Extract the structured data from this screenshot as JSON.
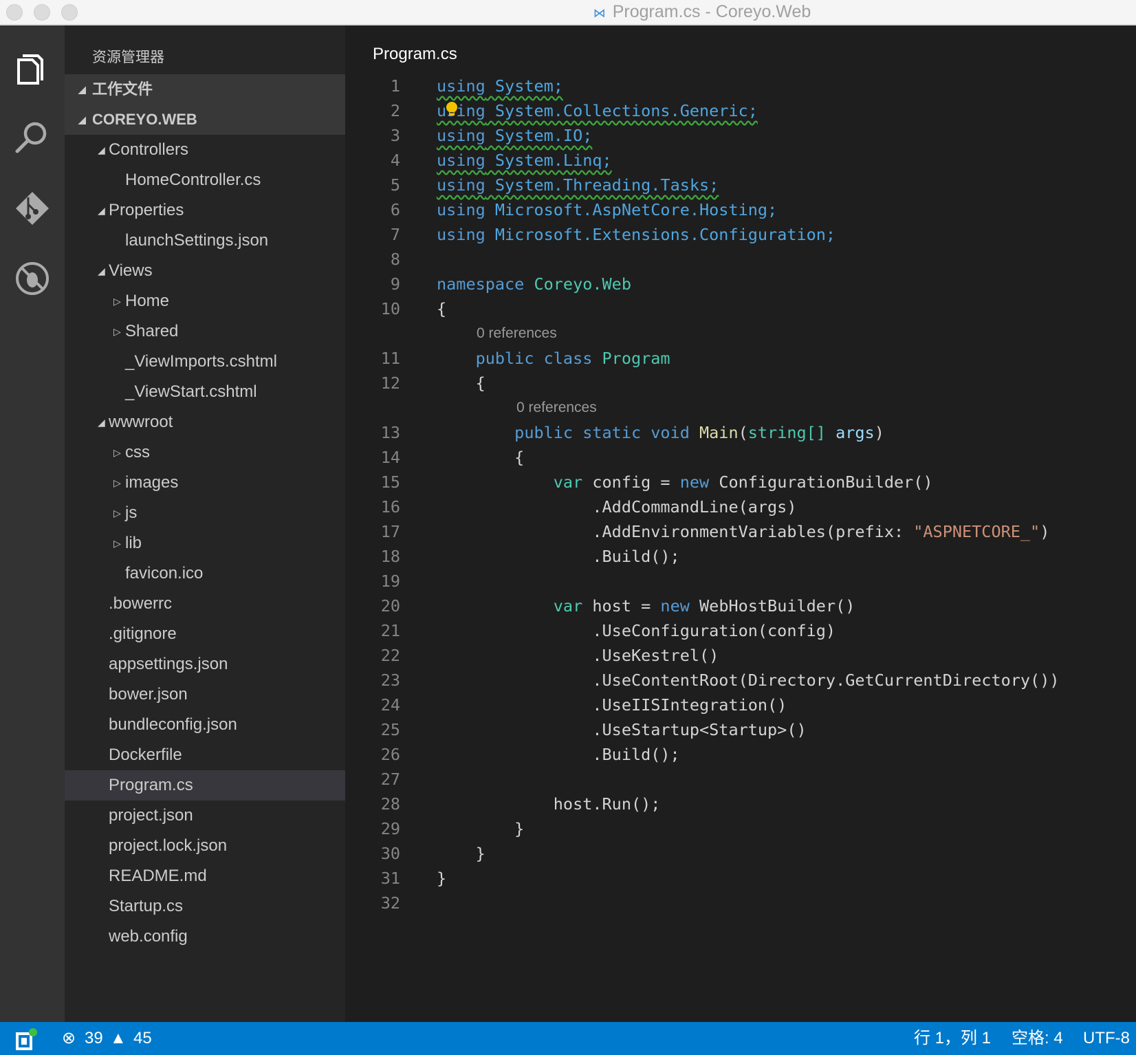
{
  "window": {
    "title": "Program.cs - Coreyo.Web"
  },
  "activity_bar": {
    "items": [
      "explorer-icon",
      "search-icon",
      "git-icon",
      "debug-icon"
    ]
  },
  "sidebar": {
    "title": "资源管理器",
    "items": [
      {
        "label": "工作文件",
        "level": 0,
        "twisty": "expanded",
        "header": true
      },
      {
        "label": "COREYO.WEB",
        "level": 0,
        "twisty": "expanded",
        "header": true
      },
      {
        "label": "Controllers",
        "level": 1,
        "twisty": "expanded"
      },
      {
        "label": "HomeController.cs",
        "level": 2
      },
      {
        "label": "Properties",
        "level": 1,
        "twisty": "expanded"
      },
      {
        "label": "launchSettings.json",
        "level": 2
      },
      {
        "label": "Views",
        "level": 1,
        "twisty": "expanded"
      },
      {
        "label": "Home",
        "level": 2,
        "twisty": "collapsed"
      },
      {
        "label": "Shared",
        "level": 2,
        "twisty": "collapsed"
      },
      {
        "label": "_ViewImports.cshtml",
        "level": 2
      },
      {
        "label": "_ViewStart.cshtml",
        "level": 2
      },
      {
        "label": "wwwroot",
        "level": 1,
        "twisty": "expanded"
      },
      {
        "label": "css",
        "level": 2,
        "twisty": "collapsed"
      },
      {
        "label": "images",
        "level": 2,
        "twisty": "collapsed"
      },
      {
        "label": "js",
        "level": 2,
        "twisty": "collapsed"
      },
      {
        "label": "lib",
        "level": 2,
        "twisty": "collapsed"
      },
      {
        "label": "favicon.ico",
        "level": 2
      },
      {
        "label": ".bowerrc",
        "level": 1
      },
      {
        "label": ".gitignore",
        "level": 1
      },
      {
        "label": "appsettings.json",
        "level": 1
      },
      {
        "label": "bower.json",
        "level": 1
      },
      {
        "label": "bundleconfig.json",
        "level": 1
      },
      {
        "label": "Dockerfile",
        "level": 1
      },
      {
        "label": "Program.cs",
        "level": 1,
        "selected": true
      },
      {
        "label": "project.json",
        "level": 1
      },
      {
        "label": "project.lock.json",
        "level": 1
      },
      {
        "label": "README.md",
        "level": 1
      },
      {
        "label": "Startup.cs",
        "level": 1
      },
      {
        "label": "web.config",
        "level": 1
      }
    ]
  },
  "editor": {
    "tab_title": "Program.cs",
    "code_lens": "0 references",
    "lines": [
      [
        [
          "k",
          "using"
        ],
        [
          "",
          ""
        ],
        [
          "n",
          " System;"
        ]
      ],
      [
        [
          "k",
          "using"
        ],
        [
          "n",
          " System.Collections.Generic;"
        ]
      ],
      [
        [
          "k",
          "using"
        ],
        [
          "n",
          " System.IO;"
        ]
      ],
      [
        [
          "k",
          "using"
        ],
        [
          "n",
          " System.Linq;"
        ]
      ],
      [
        [
          "k",
          "using"
        ],
        [
          "n",
          " System.Threading.Tasks;"
        ]
      ],
      [
        [
          "k",
          "using"
        ],
        [
          "n",
          " Microsoft.AspNetCore.Hosting;"
        ]
      ],
      [
        [
          "k",
          "using"
        ],
        [
          "n",
          " Microsoft.Extensions.Configuration;"
        ]
      ],
      [],
      [
        [
          "k",
          "namespace"
        ],
        [
          "t",
          " Coreyo.Web"
        ]
      ],
      [
        [
          "",
          "{"
        ]
      ],
      [
        [
          "k",
          "    public class"
        ],
        [
          "t",
          " Program"
        ]
      ],
      [
        [
          "",
          "    {"
        ]
      ],
      [
        [
          "k",
          "        public static void"
        ],
        [
          "m",
          " Main"
        ],
        [
          "",
          "("
        ],
        [
          "t",
          "string[]"
        ],
        [
          "p",
          " args"
        ],
        [
          "",
          ")"
        ]
      ],
      [
        [
          "",
          "        {"
        ]
      ],
      [
        [
          "t",
          "            var"
        ],
        [
          "",
          " config = "
        ],
        [
          "k",
          "new"
        ],
        [
          "",
          " ConfigurationBuilder()"
        ]
      ],
      [
        [
          "",
          "                .AddCommandLine(args)"
        ]
      ],
      [
        [
          "",
          "                .AddEnvironmentVariables(prefix: "
        ],
        [
          "s",
          "\"ASPNETCORE_\""
        ],
        [
          "",
          ")"
        ]
      ],
      [
        [
          "",
          "                .Build();"
        ]
      ],
      [],
      [
        [
          "t",
          "            var"
        ],
        [
          "",
          " host = "
        ],
        [
          "k",
          "new"
        ],
        [
          "",
          " WebHostBuilder()"
        ]
      ],
      [
        [
          "",
          "                .UseConfiguration(config)"
        ]
      ],
      [
        [
          "",
          "                .UseKestrel()"
        ]
      ],
      [
        [
          "",
          "                .UseContentRoot(Directory.GetCurrentDirectory())"
        ]
      ],
      [
        [
          "",
          "                .UseIISIntegration()"
        ]
      ],
      [
        [
          "",
          "                .UseStartup<Startup>()"
        ]
      ],
      [
        [
          "",
          "                .Build();"
        ]
      ],
      [],
      [
        [
          "",
          "            host.Run();"
        ]
      ],
      [
        [
          "",
          "        }"
        ]
      ],
      [
        [
          "",
          "    }"
        ]
      ],
      [
        [
          "",
          "}"
        ]
      ],
      []
    ],
    "warning_lines": [
      1,
      2,
      3,
      4,
      5
    ],
    "lightbulb_line": 2
  },
  "status_bar": {
    "errors": "39",
    "warnings": "45",
    "position": "行 1，列 1",
    "indent": "空格: 4",
    "encoding": "UTF-8",
    "color": "#007acc"
  }
}
